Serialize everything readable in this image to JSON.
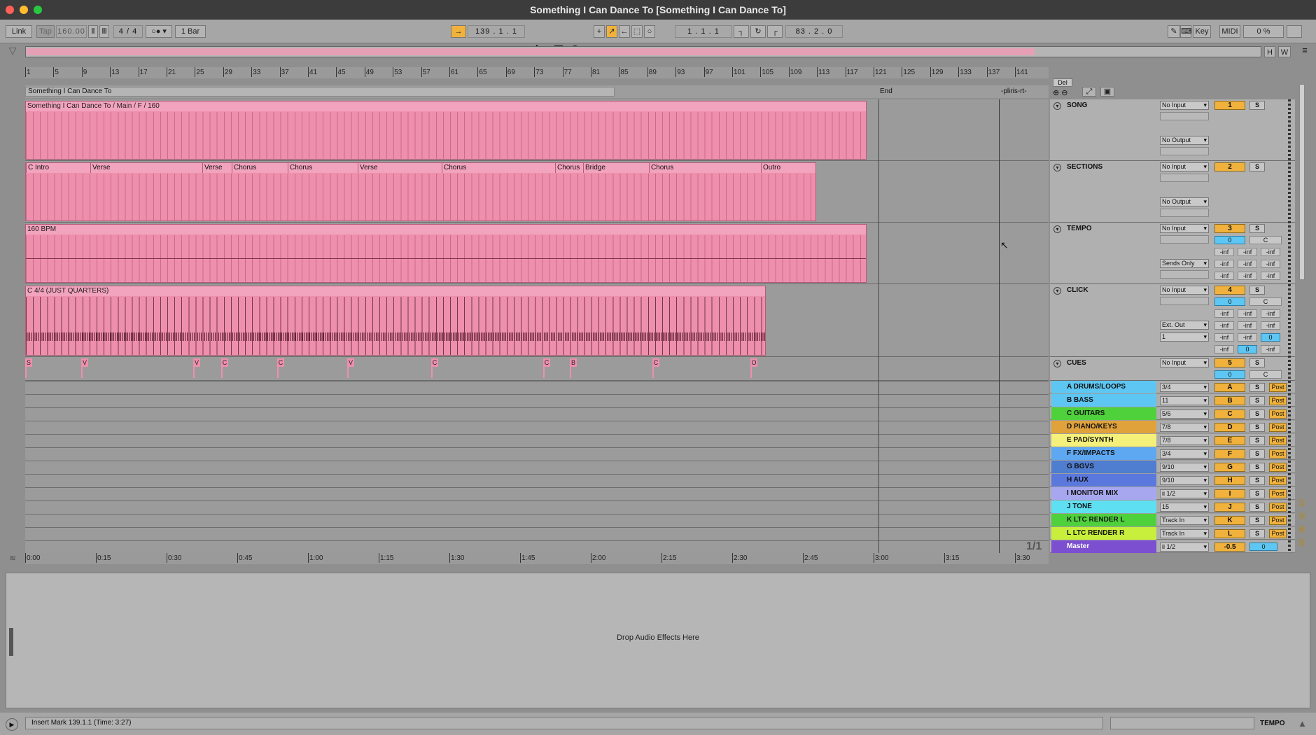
{
  "window": {
    "title": "Something I Can Dance To  [Something I Can Dance To]"
  },
  "control_bar": {
    "link": "Link",
    "tap": "Tap",
    "tempo": "160.00",
    "time_sig": "4 / 4",
    "quantize": "1 Bar",
    "arrangement_position": "139 .  1 .  1",
    "loop_start": "1 .  1 .  1",
    "loop_length": "83 .  2 .  0",
    "key": "Key",
    "midi": "MIDI",
    "cpu": "0 %"
  },
  "ruler": {
    "bars": [
      "1",
      "5",
      "9",
      "13",
      "17",
      "21",
      "25",
      "29",
      "33",
      "37",
      "41",
      "45",
      "49",
      "53",
      "57",
      "61",
      "65",
      "69",
      "73",
      "77",
      "81",
      "85",
      "89",
      "93",
      "97",
      "101",
      "105",
      "109",
      "113",
      "117",
      "121",
      "125",
      "129",
      "133",
      "137",
      "141"
    ]
  },
  "locators": {
    "song": "Something I Can Dance To",
    "end": "End",
    "plirs": "-pliris-rt-",
    "del": "Del"
  },
  "clips": {
    "song": "Something I Can Dance To / Main / F / 160",
    "tempo": "160 BPM",
    "click": "C 4/4 (JUST QUARTERS)",
    "sections": [
      "C Intro",
      "Verse",
      "Verse",
      "Chorus",
      "Chorus",
      "Verse",
      "Chorus",
      "Chorus",
      "Bridge",
      "Chorus",
      "Outro"
    ],
    "cues": [
      "S",
      "V",
      "V",
      "C",
      "C",
      "V",
      "C",
      "C",
      "B",
      "C",
      "O"
    ]
  },
  "time_ruler": {
    "labels": [
      "0:00",
      "0:15",
      "0:30",
      "0:45",
      "1:00",
      "1:15",
      "1:30",
      "1:45",
      "2:00",
      "2:15",
      "2:30",
      "2:45",
      "3:00",
      "3:15",
      "3:30"
    ],
    "page": "1/1"
  },
  "tracks": {
    "song": {
      "name": "SONG",
      "input": "No Input",
      "output": "No Output",
      "num": "1",
      "solo": "S"
    },
    "sections": {
      "name": "SECTIONS",
      "input": "No Input",
      "output": "No Output",
      "num": "2",
      "solo": "S"
    },
    "tempo": {
      "name": "TEMPO",
      "input": "No Input",
      "output": "Sends Only",
      "num": "3",
      "solo": "S",
      "vol": "0",
      "pan": "C",
      "inf": "-inf"
    },
    "click": {
      "name": "CLICK",
      "input": "No Input",
      "output": "Ext. Out",
      "out_ch": "1",
      "num": "4",
      "solo": "S",
      "vol": "0",
      "pan": "C",
      "inf": "-inf",
      "zero": "0"
    },
    "cues": {
      "name": "CUES",
      "input": "No Input",
      "num": "5",
      "solo": "S",
      "vol": "0",
      "pan": "C"
    },
    "groups": [
      {
        "name": "A DRUMS/LOOPS",
        "route": "3/4",
        "letter": "A",
        "color": "#5ec6f2"
      },
      {
        "name": "B BASS",
        "route": "11",
        "letter": "B",
        "color": "#5ec6f2"
      },
      {
        "name": "C GUITARS",
        "route": "5/6",
        "letter": "C",
        "color": "#4fd13c"
      },
      {
        "name": "D PIANO/KEYS",
        "route": "7/8",
        "letter": "D",
        "color": "#e0a23a"
      },
      {
        "name": "E PAD/SYNTH",
        "route": "7/8",
        "letter": "E",
        "color": "#f5f07a"
      },
      {
        "name": "F FX/IMPACTS",
        "route": "3/4",
        "letter": "F",
        "color": "#5ea8f2"
      },
      {
        "name": "G BGVS",
        "route": "9/10",
        "letter": "G",
        "color": "#4f7dd0"
      },
      {
        "name": "H AUX",
        "route": "9/10",
        "letter": "H",
        "color": "#5b78dd"
      },
      {
        "name": "I MONITOR MIX",
        "route": "ii 1/2",
        "letter": "I",
        "color": "#a7a7ef"
      },
      {
        "name": "J TONE",
        "route": "15",
        "letter": "J",
        "color": "#5ee0f2"
      },
      {
        "name": "K LTC RENDER L",
        "route": "Track In",
        "letter": "K",
        "color": "#4fd13c"
      },
      {
        "name": "L LTC RENDER R",
        "route": "Track In",
        "letter": "L",
        "color": "#c8ef3c"
      }
    ],
    "master": {
      "name": "Master",
      "route": "ii 1/2",
      "vol": "-0.5",
      "pan": "0"
    },
    "solo_label": "S",
    "post_label": "Post"
  },
  "device_area": {
    "drop_hint": "Drop Audio Effects Here"
  },
  "status": {
    "message": "Insert Mark 139.1.1 (Time: 3:27)",
    "right": "TEMPO"
  }
}
